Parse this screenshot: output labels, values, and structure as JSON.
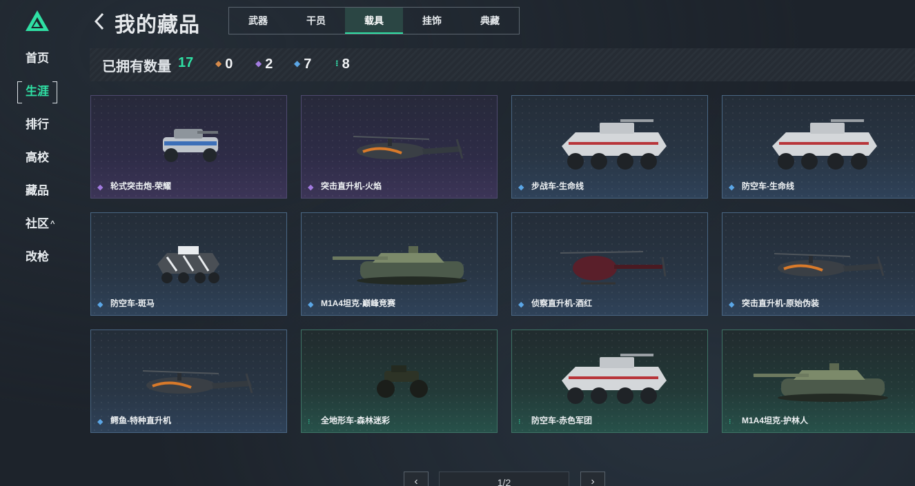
{
  "app": {
    "accent": "#2fe0a4"
  },
  "sidebar": {
    "items": [
      {
        "label": "首页"
      },
      {
        "label": "生涯"
      },
      {
        "label": "排行"
      },
      {
        "label": "高校"
      },
      {
        "label": "藏品"
      },
      {
        "label": "社区"
      },
      {
        "label": "改枪"
      }
    ],
    "active_index": 1
  },
  "header": {
    "title": "我的藏品",
    "tabs": [
      {
        "label": "武器"
      },
      {
        "label": "干员"
      },
      {
        "label": "载具"
      },
      {
        "label": "挂饰"
      },
      {
        "label": "典藏"
      }
    ],
    "active_tab": 2
  },
  "stats": {
    "label": "已拥有数量",
    "count": "17",
    "rarities": [
      {
        "icon": "orange-diamond-icon",
        "color": "#d68a4a",
        "value": "0"
      },
      {
        "icon": "purple-diamond-icon",
        "color": "#a27be0",
        "value": "2"
      },
      {
        "icon": "blue-diamond-icon",
        "color": "#5ba6e6",
        "value": "7"
      },
      {
        "icon": "green-diamond-icon",
        "color": "#33d6a4",
        "value": "8"
      }
    ]
  },
  "items": [
    {
      "name": "轮式突击炮-荣耀",
      "rarity": "purple",
      "kind": "car"
    },
    {
      "name": "突击直升机-火焰",
      "rarity": "purple",
      "kind": "heli"
    },
    {
      "name": "步战车-生命线",
      "rarity": "blue",
      "kind": "apc"
    },
    {
      "name": "防空车-生命线",
      "rarity": "blue",
      "kind": "apc"
    },
    {
      "name": "防空车-斑马",
      "rarity": "blue",
      "kind": "apc-small"
    },
    {
      "name": "M1A4坦克-巅峰竞赛",
      "rarity": "blue",
      "kind": "tank"
    },
    {
      "name": "侦察直升机-酒红",
      "rarity": "blue",
      "kind": "scout"
    },
    {
      "name": "突击直升机-原始伪装",
      "rarity": "blue",
      "kind": "heli"
    },
    {
      "name": "鳄鱼-特种直升机",
      "rarity": "blue",
      "kind": "heli"
    },
    {
      "name": "全地形车-森林迷彩",
      "rarity": "green",
      "kind": "atv"
    },
    {
      "name": "防空车-赤色军团",
      "rarity": "green",
      "kind": "apc"
    },
    {
      "name": "M1A4坦克-护林人",
      "rarity": "green",
      "kind": "tank"
    }
  ],
  "pagination": {
    "prev": "‹",
    "next": "›",
    "indicator": "1/2"
  }
}
